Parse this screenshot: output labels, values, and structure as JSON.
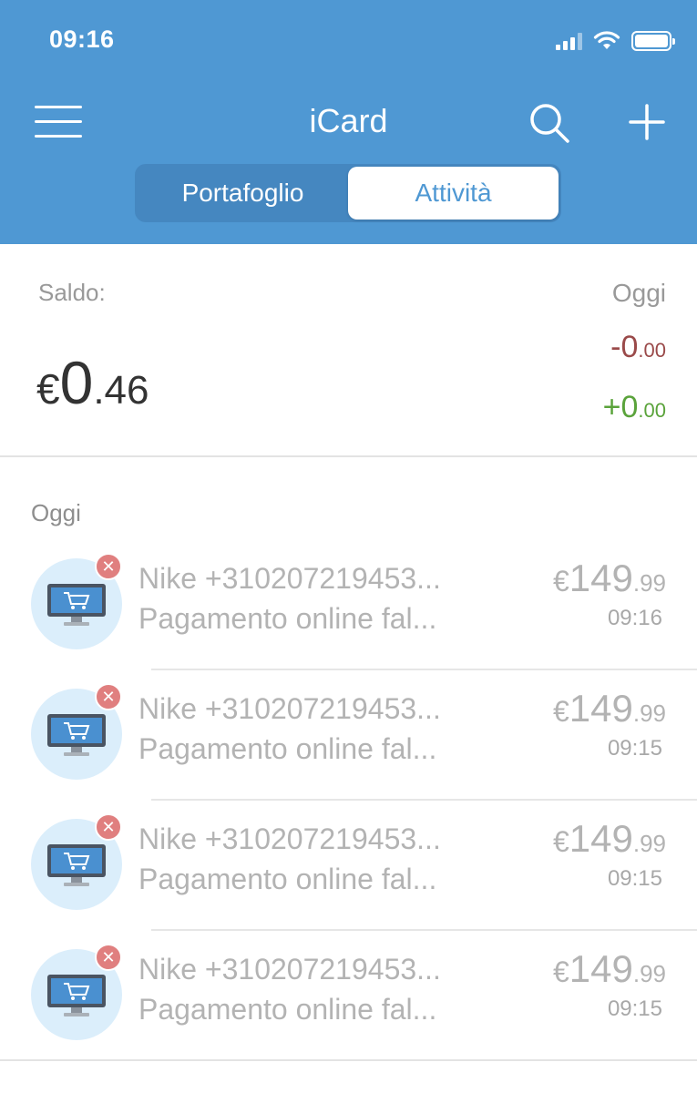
{
  "status_bar": {
    "time": "09:16"
  },
  "header": {
    "title": "iCard",
    "tabs": [
      {
        "label": "Portafoglio",
        "active": false
      },
      {
        "label": "Attività",
        "active": true
      }
    ]
  },
  "balance": {
    "label": "Saldo:",
    "currency": "€",
    "integer": "0",
    "decimal": ".46",
    "period_label": "Oggi",
    "outgoing": {
      "integer": "-0",
      "decimal": ".00"
    },
    "incoming": {
      "integer": "+0",
      "decimal": ".00"
    }
  },
  "transactions_section": {
    "header": "Oggi",
    "items": [
      {
        "merchant": "Nike +310207219453...",
        "description": "Pagamento online fal...",
        "currency": "€",
        "integer": "149",
        "decimal": ".99",
        "time": "09:16"
      },
      {
        "merchant": "Nike +310207219453...",
        "description": "Pagamento online fal...",
        "currency": "€",
        "integer": "149",
        "decimal": ".99",
        "time": "09:15"
      },
      {
        "merchant": "Nike +310207219453...",
        "description": "Pagamento online fal...",
        "currency": "€",
        "integer": "149",
        "decimal": ".99",
        "time": "09:15"
      },
      {
        "merchant": "Nike +310207219453...",
        "description": "Pagamento online fal...",
        "currency": "€",
        "integer": "149",
        "decimal": ".99",
        "time": "09:15"
      }
    ]
  },
  "icons": {
    "menu": "hamburger-menu-icon",
    "search": "search-icon",
    "add": "plus-icon",
    "transaction": "computer-cart-icon",
    "failed": "close-badge-icon"
  },
  "colors": {
    "header_bg": "#4f98d3",
    "outgoing": "#9a4a4a",
    "incoming": "#5aa33b",
    "failed_badge": "#e07f7f"
  }
}
